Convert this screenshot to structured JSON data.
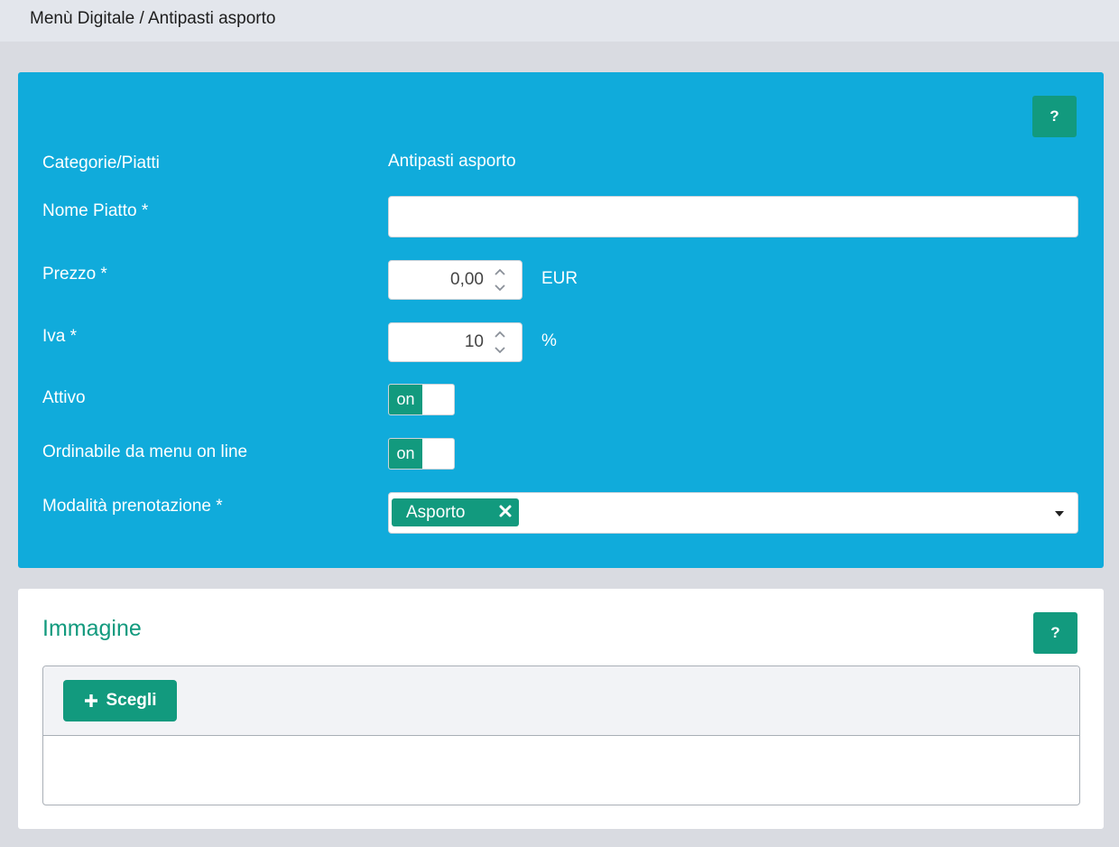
{
  "breadcrumb": "Menù Digitale / Antipasti asporto",
  "help_label": "?",
  "form": {
    "category_label": "Categorie/Piatti",
    "category_value": "Antipasti asporto",
    "name_label": "Nome Piatto *",
    "name_value": "",
    "price_label": "Prezzo *",
    "price_value": "0,00",
    "price_unit": "EUR",
    "vat_label": "Iva *",
    "vat_value": "10",
    "vat_unit": "%",
    "active_label": "Attivo",
    "active_toggle": "on",
    "orderable_label": "Ordinabile da menu on line",
    "orderable_toggle": "on",
    "booking_label": "Modalità prenotazione *",
    "booking_selected": "Asporto"
  },
  "image": {
    "title": "Immagine",
    "choose_label": "Scegli"
  },
  "colors": {
    "panel_blue": "#10abdb",
    "accent_green": "#129a7e"
  }
}
